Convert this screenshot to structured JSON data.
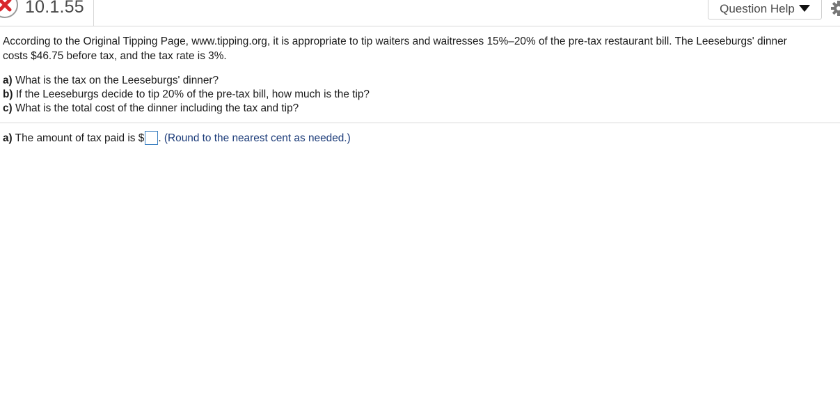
{
  "header": {
    "question_number": "10.1.55",
    "help_button_label": "Question Help"
  },
  "problem": {
    "intro_line1": "According to the Original Tipping Page, www.tipping.org, it is appropriate to tip waiters and waitresses 15%–20% of the pre-tax restaurant bill. The Leeseburgs' dinner",
    "intro_line2": "costs $46.75 before tax, and the tax rate is 3%.",
    "parts": [
      {
        "label": "a)",
        "text": " What is the tax on the Leeseburgs' dinner?"
      },
      {
        "label": "b)",
        "text": " If the Leeseburgs decide to tip 20% of the pre-tax bill, how much is the tip?"
      },
      {
        "label": "c)",
        "text": " What is the total cost of the dinner including the tax and tip?"
      }
    ]
  },
  "answer": {
    "label": "a)",
    "prefix": " The amount of tax paid is $",
    "value": "",
    "suffix": ". ",
    "hint": "(Round to the nearest cent as needed.)"
  },
  "colors": {
    "status_incorrect": "#d9262c",
    "input_border": "#3a7fc0",
    "hint_text": "#1a3a78"
  },
  "icons": [
    "incorrect-x-icon",
    "dropdown-triangle-icon",
    "gear-icon"
  ]
}
